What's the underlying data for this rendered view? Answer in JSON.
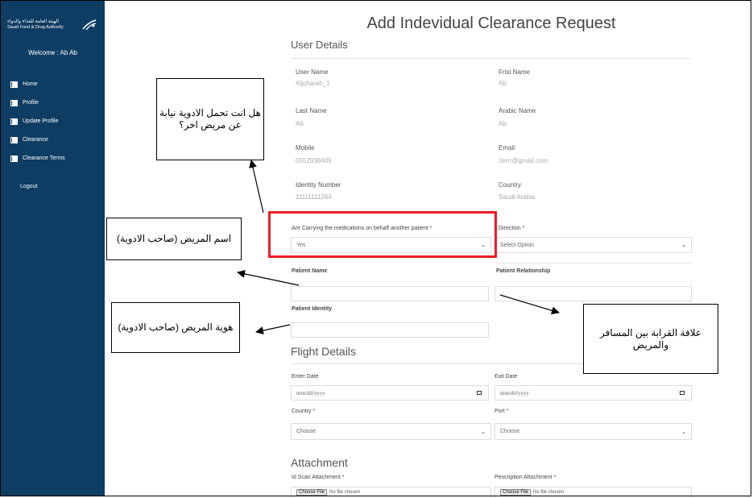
{
  "sidebar": {
    "logo_ar": "الهيئة العامة للغذاء والدواء",
    "logo_en": "Saudi Food & Drug Authority",
    "welcome": "Welcome : Ab Ab",
    "items": [
      {
        "label": "Home",
        "icon": "book-icon"
      },
      {
        "label": "Profile",
        "icon": "book-icon"
      },
      {
        "label": "Update Profile",
        "icon": "book-icon"
      },
      {
        "label": "Clearance",
        "icon": "book-icon"
      },
      {
        "label": "Clearance Terms",
        "icon": "book-icon"
      }
    ],
    "logout": "Logout"
  },
  "page": {
    "title": "Add Indevidual Clearance Request"
  },
  "user_details": {
    "title": "User Details",
    "user_name": {
      "label": "User Name",
      "value": "Aljoharah_1"
    },
    "first_name": {
      "label": "Frist Name",
      "value": "Ab"
    },
    "last_name": {
      "label": "Last Name",
      "value": "Ab"
    },
    "arabic_name": {
      "label": "Arabic Name",
      "value": "Ab"
    },
    "mobile": {
      "label": "Mobile",
      "value": "0552938409"
    },
    "email": {
      "label": "Email",
      "value": "Jerrr@gmail.com"
    },
    "identity": {
      "label": "Identity Number",
      "value": "11111111264"
    },
    "country": {
      "label": "Country",
      "value": "Saudi Arabia"
    }
  },
  "patient": {
    "carrying_label": "Are Carrying the medications on behalf another patient *",
    "carrying_value": "Yes",
    "direction_label": "Direction *",
    "direction_value": "Select Option",
    "name_label": "Patient Name",
    "relationship_label": "Patient Relationship",
    "identity_label": "Patient Identity"
  },
  "flight": {
    "title": "Flight Details",
    "enter_date_label": "Enter Date",
    "enter_date_placeholder": "mm/dd/yyyy",
    "exit_date_label": "Exit Date",
    "exit_date_placeholder": "mm/dd/yyyy",
    "country_label": "Country *",
    "country_value": "Choose",
    "port_label": "Port *",
    "port_value": "Choose"
  },
  "attachment": {
    "title": "Attachment",
    "id_scan_label": "Id Scan Attachment *",
    "prescription_label": "Pescription Attachment *",
    "choose_file": "Choose File",
    "no_file": "No file chosen"
  },
  "annotations": {
    "carrying_question": "هل انت تحمل الادوية نيابة عن مريض اخر؟",
    "patient_name": "اسم المريض (صاحب الادوية)",
    "patient_identity": "هوية المريض (صاحب الادوية)",
    "relationship": "علاقة القرابة بين المسافر والمريض"
  },
  "colors": {
    "sidebar": "#0e3d63",
    "highlight": "#ee1c25"
  }
}
